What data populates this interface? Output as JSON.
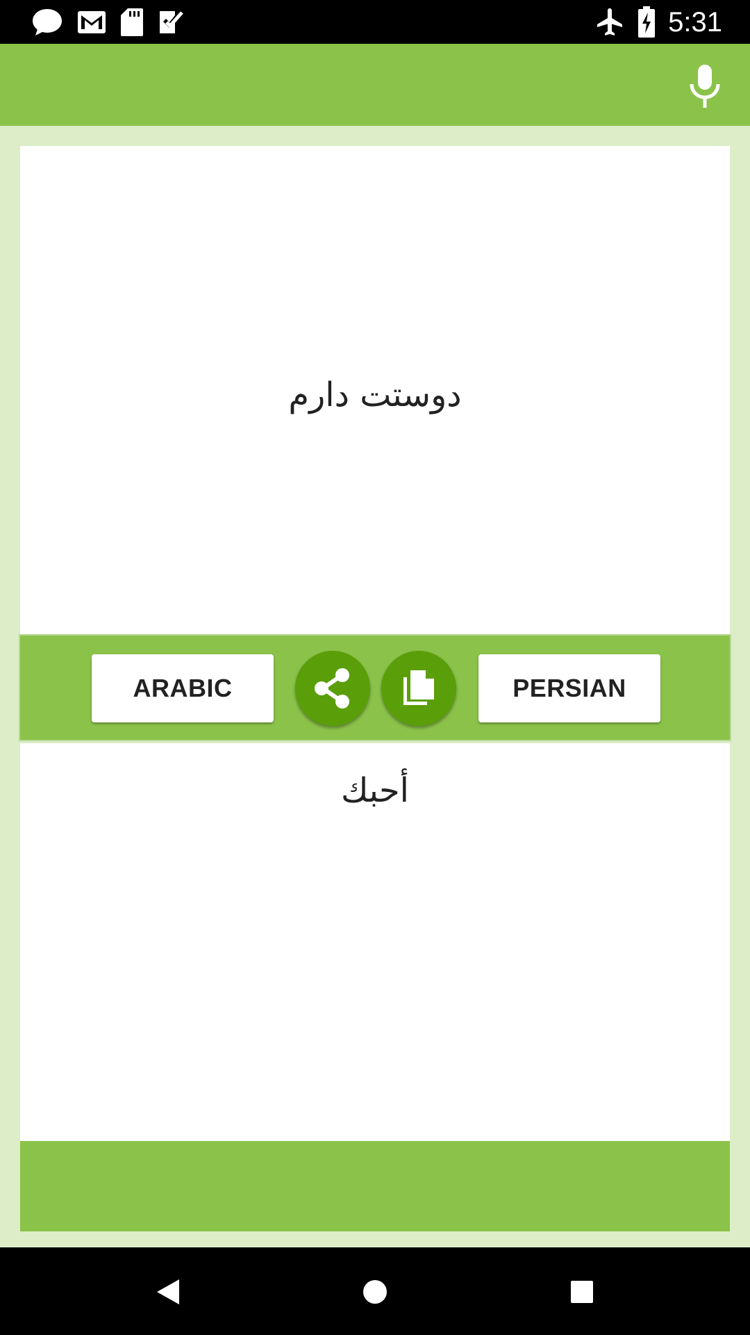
{
  "status_bar": {
    "time": "5:31",
    "left_icons": [
      "chat-bubble-icon",
      "gmail-icon",
      "sd-card-icon",
      "task-check-icon"
    ],
    "right_icons": [
      "airplane-mode-icon",
      "battery-charging-icon"
    ]
  },
  "toolbar": {
    "mic_icon": "microphone-icon",
    "background": "#8bc34a"
  },
  "translator": {
    "source_text": "دوستت دارم",
    "target_text": "أحبك",
    "source_language": "ARABIC",
    "target_language": "PERSIAN",
    "share_icon": "share-icon",
    "copy_icon": "copy-icon"
  },
  "colors": {
    "accent": "#8bc34a",
    "fab": "#5a9e0a",
    "page_background": "#dcedc8"
  },
  "nav_bar": {
    "icons": [
      "back-triangle-icon",
      "home-circle-icon",
      "recents-square-icon"
    ]
  }
}
